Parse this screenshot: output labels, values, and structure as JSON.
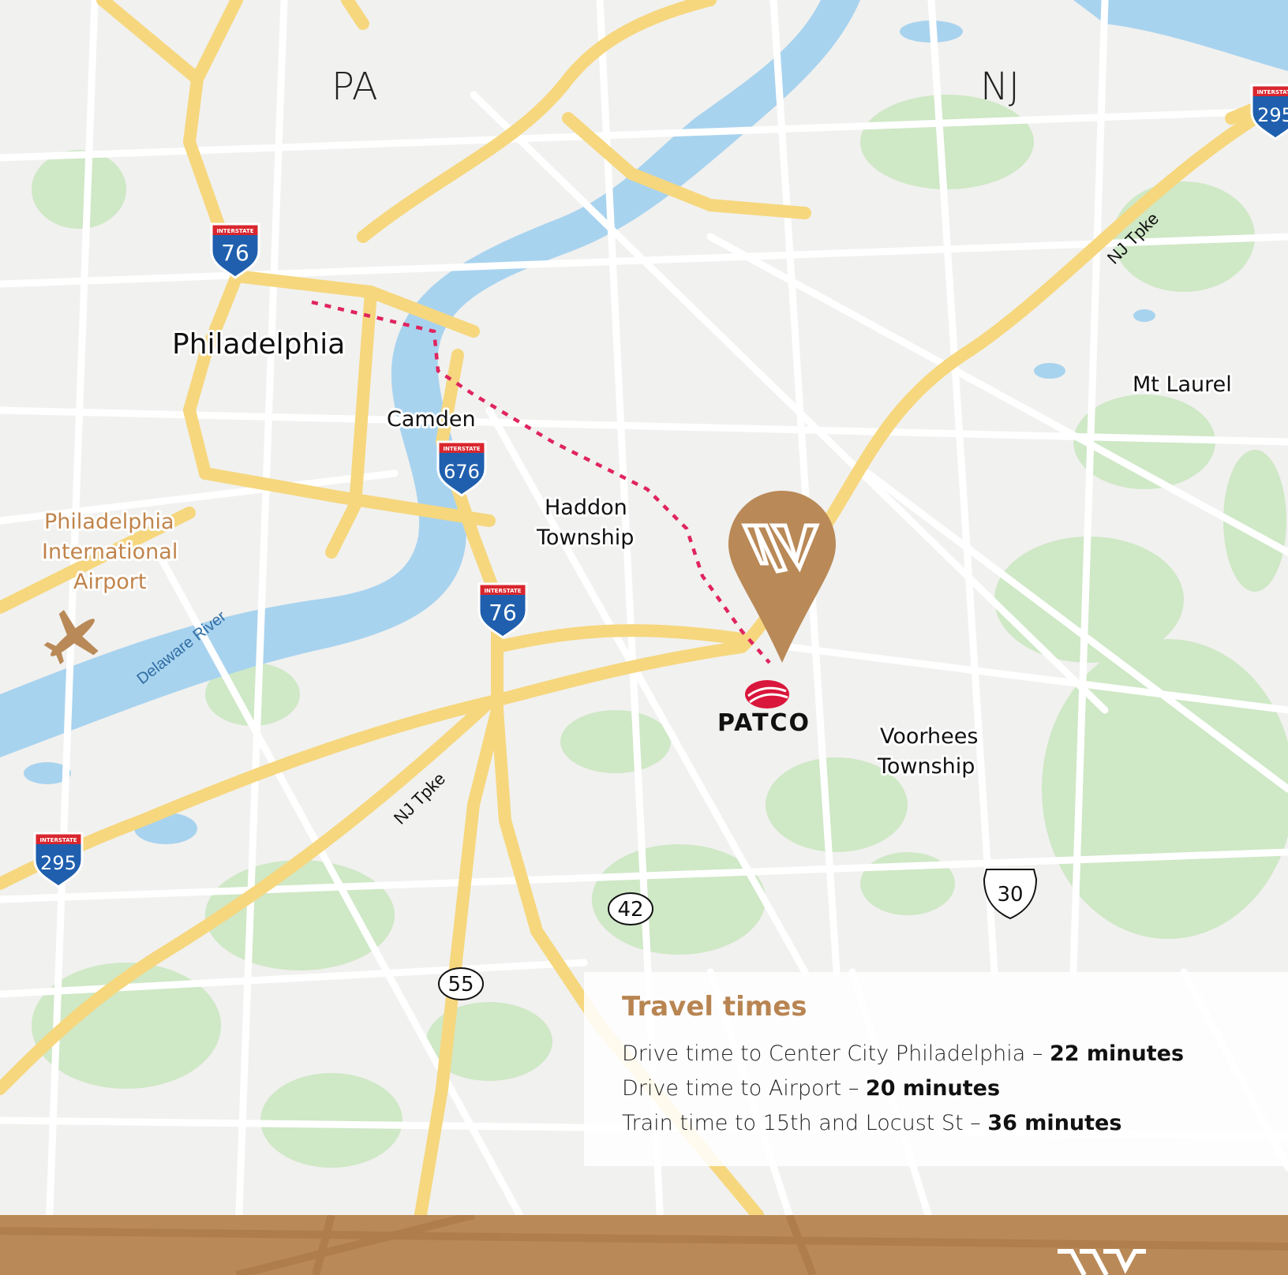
{
  "colors": {
    "accent": "#b98957",
    "highway": "#f6d77e",
    "water": "#a8d3ef",
    "park": "#cde8c4",
    "patco_red": "#d9163b",
    "interstate_blue": "#1f5fae",
    "interstate_red": "#d9262e"
  },
  "regions": {
    "pa": "PA",
    "nj": "NJ"
  },
  "places": {
    "philadelphia": "Philadelphia",
    "camden": "Camden",
    "haddon_line1": "Haddon",
    "haddon_line2": "Township",
    "mt_laurel": "Mt Laurel",
    "voorhees_line1": "Voorhees",
    "voorhees_line2": "Township",
    "airport_line1": "Philadelphia",
    "airport_line2": "International",
    "airport_line3": "Airport"
  },
  "water_labels": {
    "delaware_river": "Delaware River"
  },
  "road_labels": {
    "nj_tpke_north": "NJ Tpke",
    "nj_tpke_south": "NJ Tpke"
  },
  "shields": {
    "interstate_top": "INTERSTATE",
    "i76_west": "76",
    "i676": "676",
    "i76_east": "76",
    "i295_west": "295",
    "i295_east": "295",
    "rt42": "42",
    "rt55": "55",
    "us30": "30"
  },
  "markers": {
    "location_pin": "location-pin-icon",
    "patco_logo_text": "PATCO",
    "airport_icon": "airplane-icon"
  },
  "travel_times": {
    "title": "Travel times",
    "rows": [
      {
        "label": "Drive time to Center City Philadelphia – ",
        "value": "22 minutes"
      },
      {
        "label": "Drive time to Airport – ",
        "value": "20 minutes"
      },
      {
        "label": "Train time to 15th and Locust St – ",
        "value": "36 minutes"
      }
    ]
  }
}
